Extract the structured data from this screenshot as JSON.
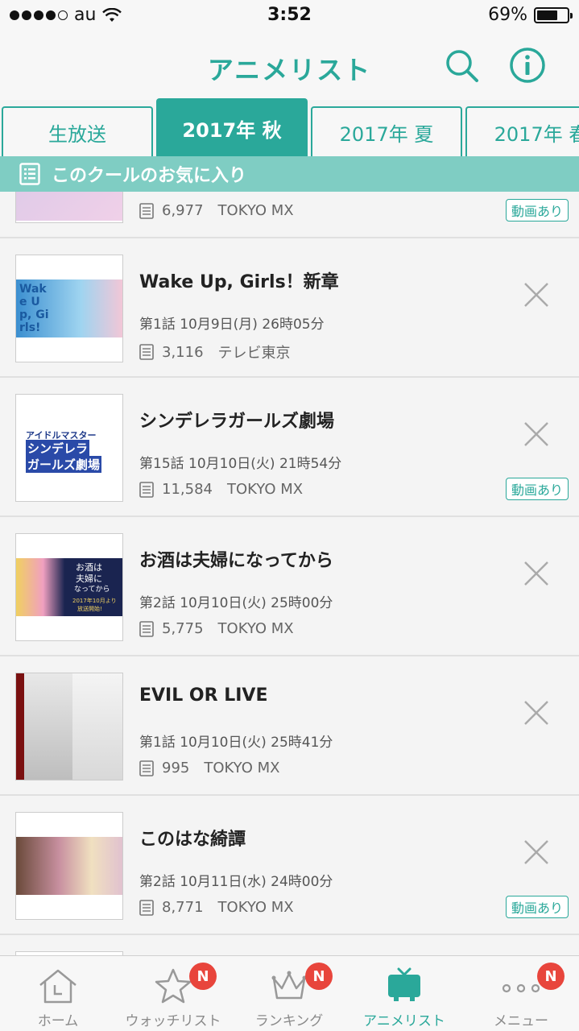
{
  "status_bar": {
    "carrier": "au",
    "time": "3:52",
    "battery": "69%",
    "battery_level": 0.69
  },
  "header": {
    "title": "アニメリスト"
  },
  "tabs": [
    {
      "label": "生放送"
    },
    {
      "label": "2017年 秋"
    },
    {
      "label": "2017年 夏"
    },
    {
      "label": "2017年 春"
    }
  ],
  "favorites_bar": {
    "label": "このクールのお気に入り"
  },
  "items": [
    {
      "title": "",
      "episode": "",
      "views": "6,977",
      "station": "TOKYO MX",
      "badge": "動画あり"
    },
    {
      "title": "Wake Up, Girls！新章",
      "episode": "第1話 10月9日(月) 26時05分",
      "views": "3,116",
      "station": "テレビ東京",
      "badge": ""
    },
    {
      "title": "シンデレラガールズ劇場",
      "episode": "第15話 10月10日(火) 21時54分",
      "views": "11,584",
      "station": "TOKYO MX",
      "badge": "動画あり"
    },
    {
      "title": "お酒は夫婦になってから",
      "episode": "第2話 10月10日(火) 25時00分",
      "views": "5,775",
      "station": "TOKYO MX",
      "badge": ""
    },
    {
      "title": "EVIL OR LIVE",
      "episode": "第1話 10月10日(火) 25時41分",
      "views": "995",
      "station": "TOKYO MX",
      "badge": ""
    },
    {
      "title": "このはな綺譚",
      "episode": "第2話 10月11日(水) 24時00分",
      "views": "8,771",
      "station": "TOKYO MX",
      "badge": "動画あり"
    }
  ],
  "thumbs": {
    "wug": "Wake Up, Girls!",
    "cg": [
      "アイドルマスター",
      "シンデレラ",
      "ガールズ劇場"
    ],
    "osake": [
      "お酒は",
      "夫婦に",
      "なってから",
      "2017年10月より",
      "放送開始!"
    ]
  },
  "bottom_nav": [
    {
      "label": "ホーム",
      "badge": ""
    },
    {
      "label": "ウォッチリスト",
      "badge": "N"
    },
    {
      "label": "ランキング",
      "badge": "N"
    },
    {
      "label": "アニメリスト",
      "badge": ""
    },
    {
      "label": "メニュー",
      "badge": "N"
    }
  ],
  "colors": {
    "accent": "#2aa89a",
    "accent_light": "#7fcdc3",
    "badge_red": "#e8453c"
  }
}
